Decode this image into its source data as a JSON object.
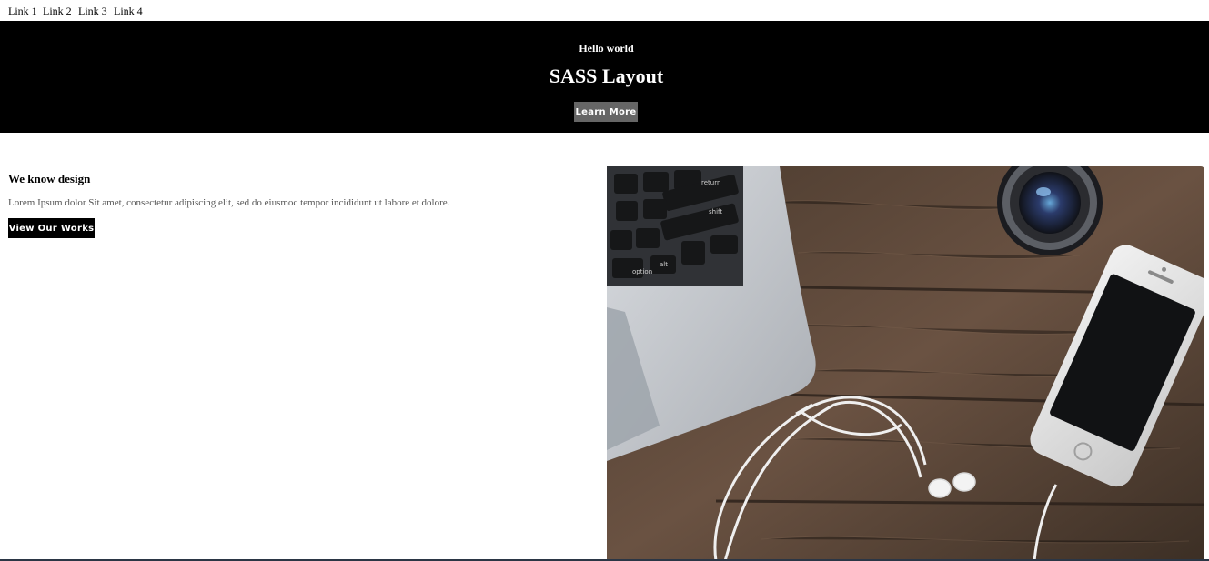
{
  "nav": {
    "links": [
      "Link 1",
      "Link 2",
      "Link 3",
      "Link 4"
    ]
  },
  "hero": {
    "eyebrow": "Hello world",
    "title": "SASS Layout",
    "button_label": "Learn More"
  },
  "feature": {
    "title": "We know design",
    "text": "Lorem Ipsum dolor Sit amet, consectetur adipiscing elit, sed do eiusmoc tempor incididunt ut labore et dolore.",
    "button_label": "View Our Works"
  },
  "photo": {
    "keycaps": [
      "return",
      "shift",
      "option",
      "alt"
    ]
  },
  "colors": {
    "hero_bg": "#000000",
    "hero_button": "#666666",
    "feature_button": "#000000",
    "wood": "#5b4637"
  }
}
